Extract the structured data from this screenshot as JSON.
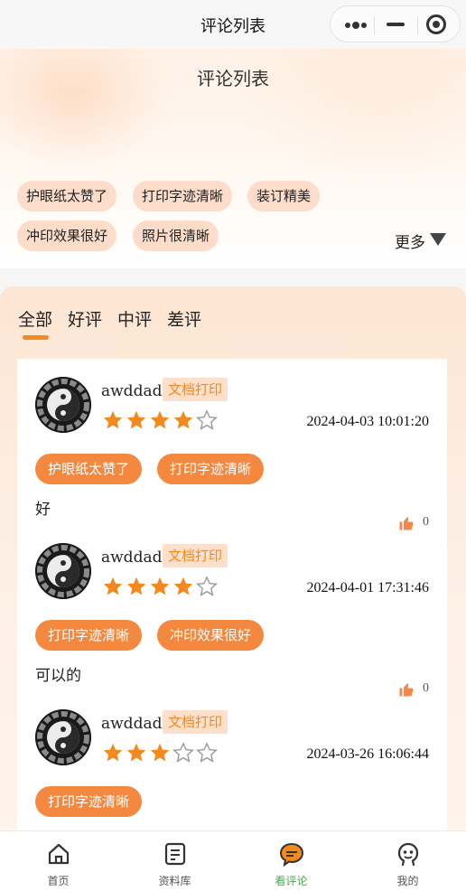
{
  "nav": {
    "title": "评论列表"
  },
  "header": {
    "title": "评论列表",
    "tags": [
      "护眼纸太赞了",
      "打印字迹清晰",
      "装订精美",
      "冲印效果很好",
      "照片很清晰"
    ],
    "more_label": "更多"
  },
  "filter_tabs": [
    "全部",
    "好评",
    "中评",
    "差评"
  ],
  "active_tab": "全部",
  "reviews": [
    {
      "username": "awddad",
      "badge": "文档打印",
      "rating": 4,
      "date": "2024-04-03 10:01:20",
      "tags": [
        "护眼纸太赞了",
        "打印字迹清晰"
      ],
      "content": "好",
      "likes": "0"
    },
    {
      "username": "awddad",
      "badge": "文档打印",
      "rating": 4,
      "date": "2024-04-01 17:31:46",
      "tags": [
        "打印字迹清晰",
        "冲印效果很好"
      ],
      "content": "可以的",
      "likes": "0"
    },
    {
      "username": "awddad",
      "badge": "文档打印",
      "rating": 3,
      "date": "2024-03-26 16:06:44",
      "tags": [
        "打印字迹清晰"
      ],
      "content": "",
      "likes": ""
    }
  ],
  "tabbar": [
    {
      "label": "首页",
      "icon": "home-icon",
      "active": false
    },
    {
      "label": "资料库",
      "icon": "document-icon",
      "active": false
    },
    {
      "label": "看评论",
      "icon": "comment-icon",
      "active": true
    },
    {
      "label": "我的",
      "icon": "profile-icon",
      "active": false
    }
  ],
  "colors": {
    "accent": "#f28a1f",
    "tag_bg": "#fddcc9",
    "review_tag_bg": "#f5883f",
    "star": "#f28a1f",
    "active_tab_text": "#3fae42"
  }
}
